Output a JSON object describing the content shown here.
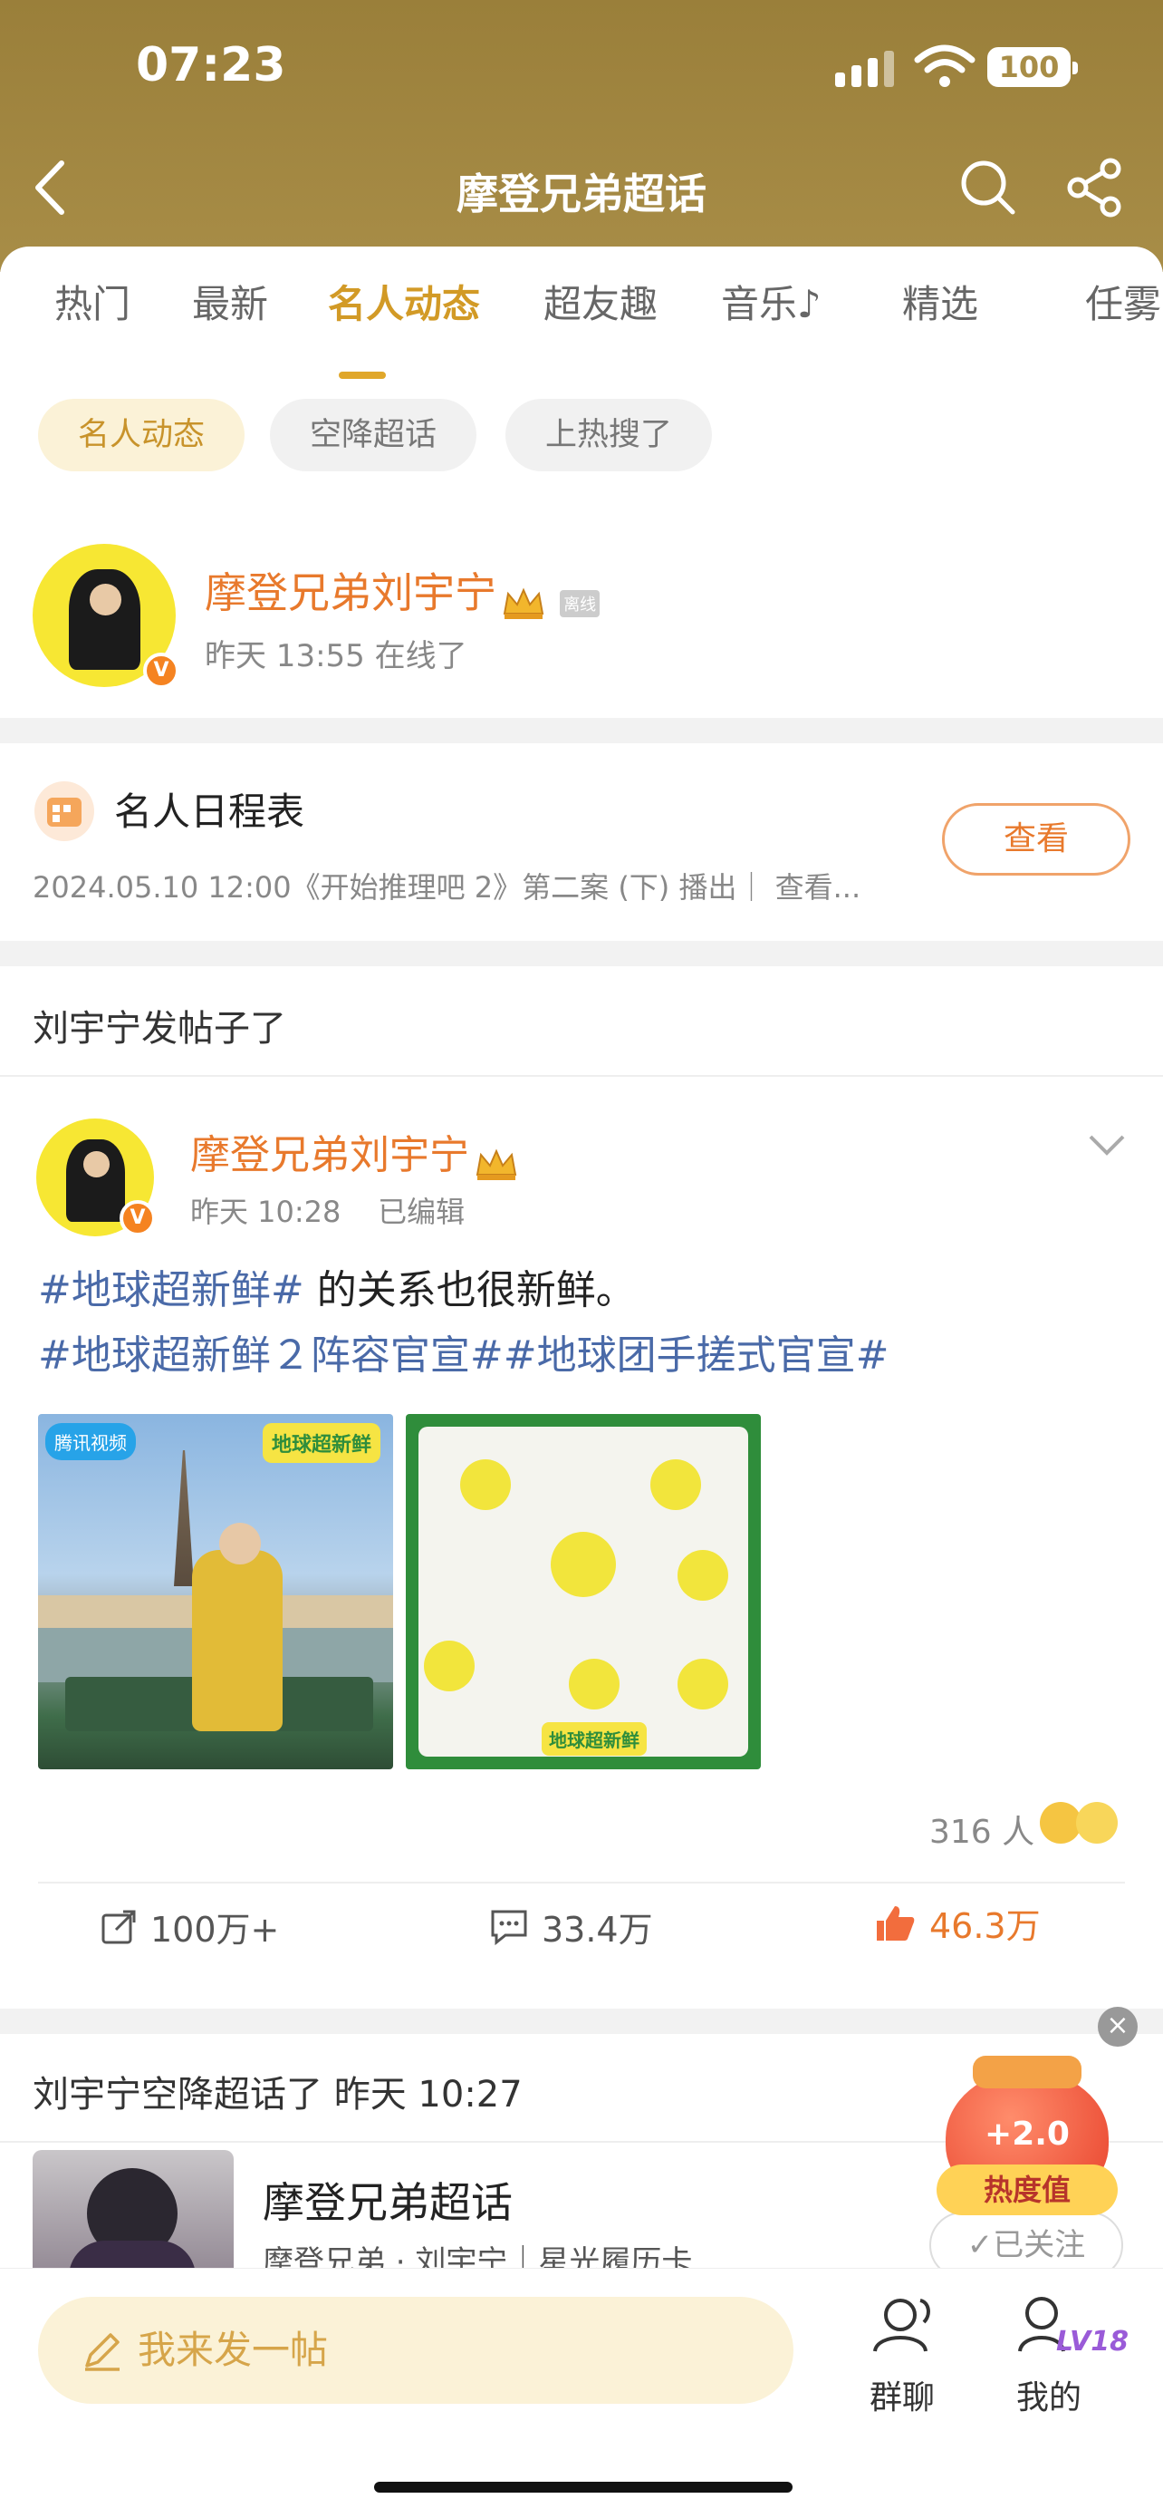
{
  "status": {
    "time": "07:23",
    "battery": "100"
  },
  "nav": {
    "title": "摩登兄弟超话"
  },
  "tabs": [
    {
      "label": "热门"
    },
    {
      "label": "最新"
    },
    {
      "label": "名人动态"
    },
    {
      "label": "超友趣"
    },
    {
      "label": "音乐♪"
    },
    {
      "label": "精选"
    },
    {
      "label": "任雾"
    }
  ],
  "chips": [
    {
      "label": "名人动态"
    },
    {
      "label": "空降超话"
    },
    {
      "label": "上热搜了"
    }
  ],
  "celebrity": {
    "name": "摩登兄弟刘宇宁",
    "offline_badge": "离线",
    "online_status": "昨天 13:55 在线了"
  },
  "schedule": {
    "title": "名人日程表",
    "detail": "2024.05.10 12:00《开始推理吧 2》第二案 (下) 播出｜ 查看...",
    "button": "查看"
  },
  "section_posted": {
    "title": "刘宇宁发帖子了"
  },
  "post": {
    "author": "摩登兄弟刘宇宁",
    "time": "昨天 10:28",
    "edited": "已编辑",
    "tag1": "#地球超新鲜#",
    "text1": " 的关系也很新鲜。",
    "tag2": "#地球超新鲜２阵容官宣#",
    "tag3": "#地球团手搓式官宣#",
    "img1_watermark": "腾讯视频",
    "img_logo": "地球超新鲜",
    "reactions_count": "316 人",
    "repost": "100万+",
    "comments": "33.4万",
    "likes": "46.3万"
  },
  "section_airdrop": {
    "title": "刘宇宁空降超话了 昨天 10:27"
  },
  "supertopic": {
    "name": "摩登兄弟超话",
    "sub": "摩登兄弟 · 刘宇宁｜星光履历卡 ...",
    "follow_button": "✓已关注"
  },
  "heat_popup": {
    "value": "+2.0",
    "label": "热度值"
  },
  "bottom": {
    "post_placeholder": "我来发一帖",
    "group_chat": "群聊",
    "mine": "我的",
    "level": "LV18"
  },
  "colors": {
    "header": "#a88d47",
    "accent": "#e0a72a",
    "orange": "#e8792c",
    "hashtag": "#4a6aa8"
  }
}
